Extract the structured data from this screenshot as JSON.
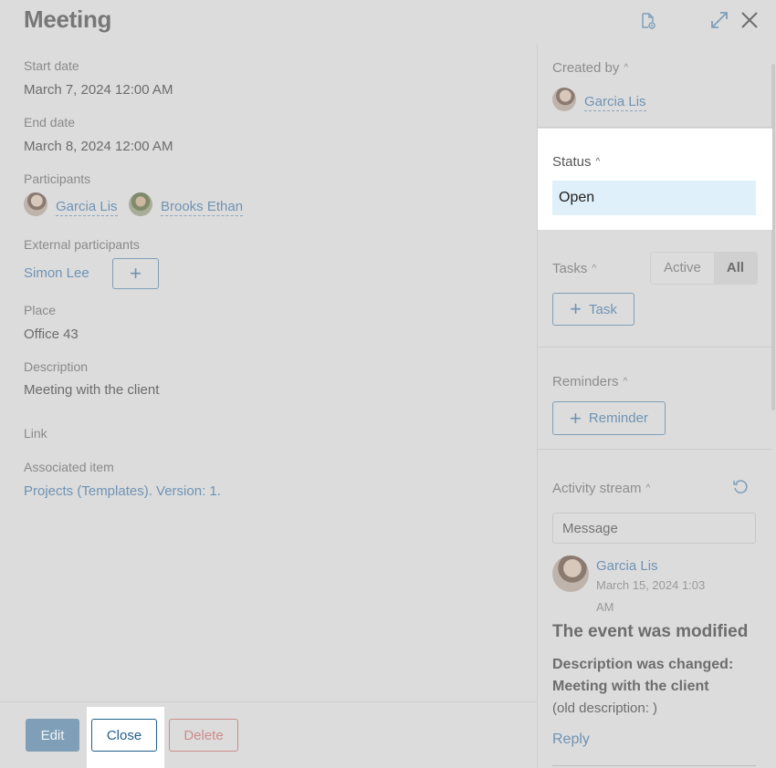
{
  "title": "Meeting",
  "fields": {
    "start_date": {
      "label": "Start date",
      "value": "March 7, 2024 12:00 AM"
    },
    "end_date": {
      "label": "End date",
      "value": "March 8, 2024 12:00 AM"
    },
    "participants": {
      "label": "Participants",
      "people": [
        "Garcia Lis",
        "Brooks Ethan"
      ]
    },
    "external": {
      "label": "External participants",
      "value": "Simon Lee",
      "add_label": "+"
    },
    "place": {
      "label": "Place",
      "value": "Office 43"
    },
    "description": {
      "label": "Description",
      "value": "Meeting with the client"
    },
    "link": {
      "label": "Link"
    },
    "associated": {
      "label": "Associated item",
      "value": "Projects (Templates). Version: 1."
    }
  },
  "right": {
    "created_by": {
      "label": "Created by",
      "name": "Garcia Lis"
    },
    "status": {
      "label": "Status",
      "value": "Open"
    },
    "tasks": {
      "label": "Tasks",
      "filter_active": "Active",
      "filter_all": "All",
      "add_label": "Task"
    },
    "reminders": {
      "label": "Reminders",
      "add_label": "Reminder"
    },
    "activity": {
      "label": "Activity stream",
      "placeholder": "Message",
      "entry": {
        "author": "Garcia Lis",
        "date_line1": "March 15, 2024 1:03",
        "date_line2": "AM",
        "headline": "The event was modified",
        "change_line1": "Description was changed:",
        "change_line2": "Meeting with the client",
        "old": "(old description: )",
        "reply": "Reply"
      }
    }
  },
  "footer": {
    "edit": "Edit",
    "close": "Close",
    "delete": "Delete"
  },
  "icons": {
    "caret": "^",
    "close_x": "✕",
    "expand": "⤢",
    "refresh": "↻",
    "doc": "document-settings"
  }
}
